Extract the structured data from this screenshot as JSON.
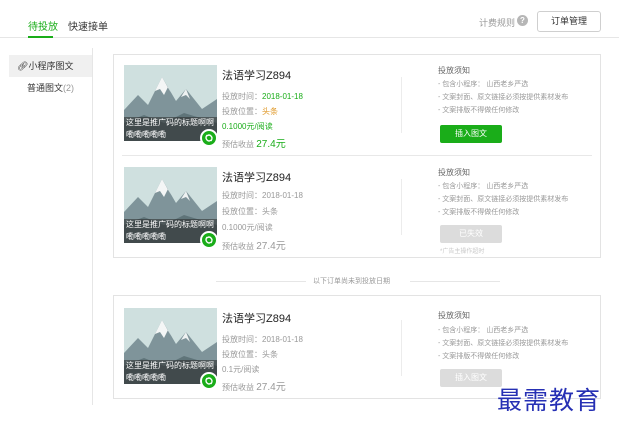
{
  "tabs": [
    {
      "label": "待投放",
      "active": true
    },
    {
      "label": "快速接单",
      "active": false
    }
  ],
  "header": {
    "rules_label": "计费规则",
    "help_icon": "?",
    "order_button": "订单管理"
  },
  "sidebar": {
    "items": [
      {
        "icon": "link-icon",
        "label": "小程序图文",
        "count": ""
      },
      {
        "icon": "",
        "label": "普通图文",
        "count": "(2)"
      }
    ]
  },
  "thumbnail_caption": "这里是推广码的标题啊啊嘞嘞嘞嘞嘞",
  "labels": {
    "time": "投放时间：",
    "position": "投放位置：",
    "earnings": "预估收益",
    "notice_title": "投放须知"
  },
  "notices": [
    "- 包含小程序： 山西老乡严选",
    "- 文案封面、原文链接必须按提供素材发布",
    "- 文案排版不得做任何修改"
  ],
  "cards": [
    {
      "title": "法语学习Z894",
      "time": "2018-01-18",
      "position": "头条",
      "price": "0.1000元/阅读",
      "earnings": "27.4元",
      "button": "插入图文",
      "tip": ""
    },
    {
      "title": "法语学习Z894",
      "time": "2018-01-18",
      "position": "头条",
      "price": "0.1000元/阅读",
      "earnings": "27.4元",
      "button": "已失效",
      "tip": "*广告主操作超时"
    },
    {
      "title": "法语学习Z894",
      "time": "2018-01-18",
      "position": "头条",
      "price": "0.1元/阅读",
      "earnings": "27.4元",
      "button": "插入图文",
      "tip": ""
    }
  ],
  "divider_text": "以下订单尚未到投放日期",
  "watermark": "最需教育",
  "colors": {
    "accent": "#1aad19",
    "orange": "#e09a2b",
    "watermark": "#2630b4"
  }
}
